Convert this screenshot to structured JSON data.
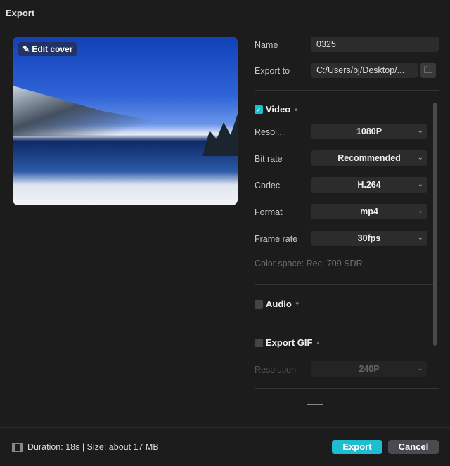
{
  "window": {
    "title": "Export"
  },
  "cover": {
    "edit_label": "Edit cover"
  },
  "name": {
    "label": "Name",
    "value": "0325"
  },
  "export_to": {
    "label": "Export to",
    "value": "C:/Users/bj/Desktop/..."
  },
  "video": {
    "label": "Video",
    "checked": true,
    "resolution": {
      "label": "Resol...",
      "value": "1080P"
    },
    "bitrate": {
      "label": "Bit rate",
      "value": "Recommended"
    },
    "codec": {
      "label": "Codec",
      "value": "H.264"
    },
    "format": {
      "label": "Format",
      "value": "mp4"
    },
    "framerate": {
      "label": "Frame rate",
      "value": "30fps"
    },
    "color_space": "Color space: Rec. 709 SDR"
  },
  "audio": {
    "label": "Audio",
    "checked": false
  },
  "gif": {
    "label": "Export GIF",
    "checked": false,
    "resolution": {
      "label": "Resolution",
      "value": "240P"
    }
  },
  "footer": {
    "info": "Duration: 18s | Size: about 17 MB",
    "export": "Export",
    "cancel": "Cancel"
  },
  "colors": {
    "accent": "#1fbdd0",
    "background": "#1c1c1c"
  }
}
